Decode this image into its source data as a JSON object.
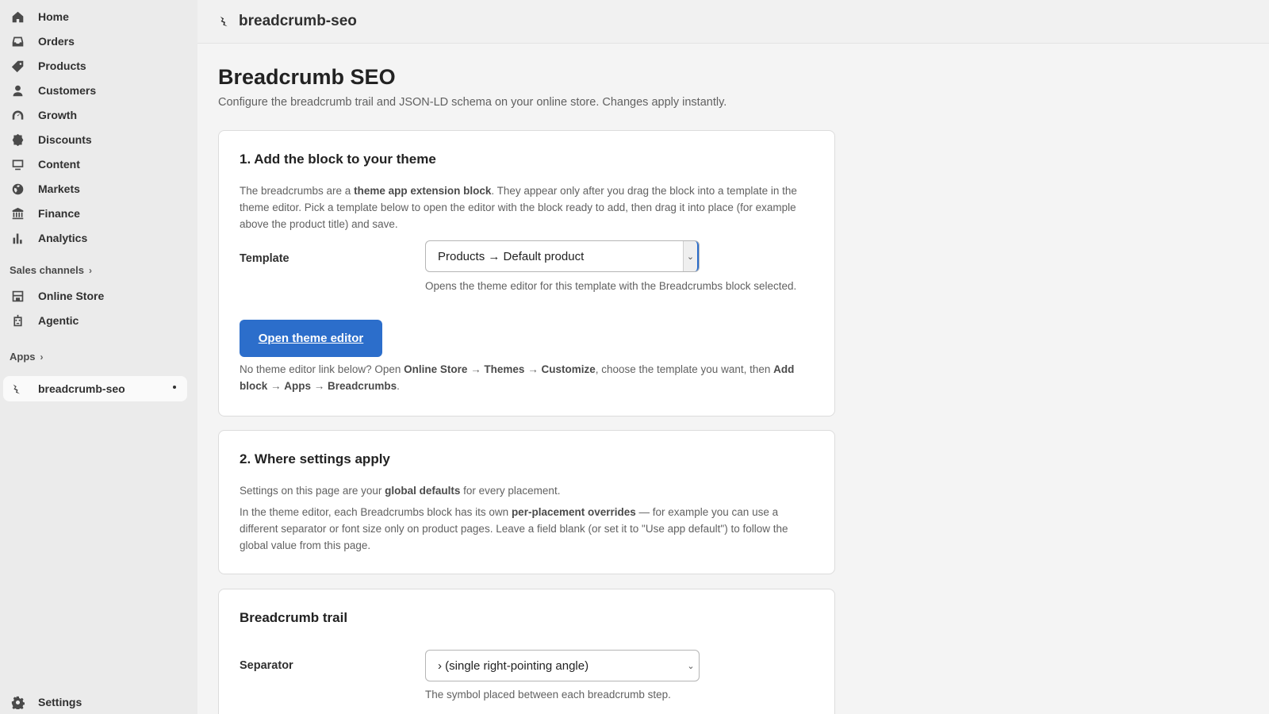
{
  "sidebar": {
    "items": [
      {
        "label": "Home",
        "icon": "home-icon"
      },
      {
        "label": "Orders",
        "icon": "inbox-icon"
      },
      {
        "label": "Products",
        "icon": "tag-icon"
      },
      {
        "label": "Customers",
        "icon": "person-icon"
      },
      {
        "label": "Growth",
        "icon": "gauge-icon"
      },
      {
        "label": "Discounts",
        "icon": "discount-icon"
      },
      {
        "label": "Content",
        "icon": "content-icon"
      },
      {
        "label": "Markets",
        "icon": "globe-icon"
      },
      {
        "label": "Finance",
        "icon": "bank-icon"
      },
      {
        "label": "Analytics",
        "icon": "bar-chart-icon"
      }
    ],
    "sales_channels_label": "Sales channels",
    "channels": [
      {
        "label": "Online Store",
        "icon": "store-icon"
      },
      {
        "label": "Agentic",
        "icon": "robot-icon"
      }
    ],
    "apps_label": "Apps",
    "active_app": {
      "label": "breadcrumb-seo",
      "icon": "breadcrumb-app-icon"
    },
    "settings_label": "Settings"
  },
  "topbar": {
    "title": "breadcrumb-seo"
  },
  "page": {
    "title": "Breadcrumb SEO",
    "subtitle": "Configure the breadcrumb trail and JSON-LD schema on your online store. Changes apply instantly."
  },
  "card1": {
    "heading": "1. Add the block to your theme",
    "p_a": "The breadcrumbs are a ",
    "p_b": "theme app extension block",
    "p_c": ". They appear only after you drag the block into a template in the theme editor. Pick a template below to open the editor with the block ready to add, then drag it into place (for example above the product title) and save.",
    "template_label": "Template",
    "template_value": "Products → Default product",
    "template_hint": "Opens the theme editor for this template with the Breadcrumbs block selected.",
    "button_label": "Open theme editor",
    "n1": "No theme editor link below? Open ",
    "n2": "Online Store",
    "n3": " → ",
    "n4": "Themes",
    "n5": " → ",
    "n6": "Customize",
    "n7": ", choose the template you want, then ",
    "n8": "Add block",
    "n9": " → ",
    "n10": "Apps",
    "n11": " → ",
    "n12": "Breadcrumbs",
    "n13": "."
  },
  "card2": {
    "heading": "2. Where settings apply",
    "p1a": "Settings on this page are your ",
    "p1b": "global defaults",
    "p1c": " for every placement.",
    "p2a": "In the theme editor, each Breadcrumbs block has its own ",
    "p2b": "per-placement overrides",
    "p2c": " — for example you can use a different separator or font size only on product pages. Leave a field blank (or set it to \"Use app default\") to follow the global value from this page."
  },
  "card3": {
    "heading": "Breadcrumb trail",
    "separator_label": "Separator",
    "separator_value": "› (single right-pointing angle)",
    "separator_hint": "The symbol placed between each breadcrumb step."
  }
}
